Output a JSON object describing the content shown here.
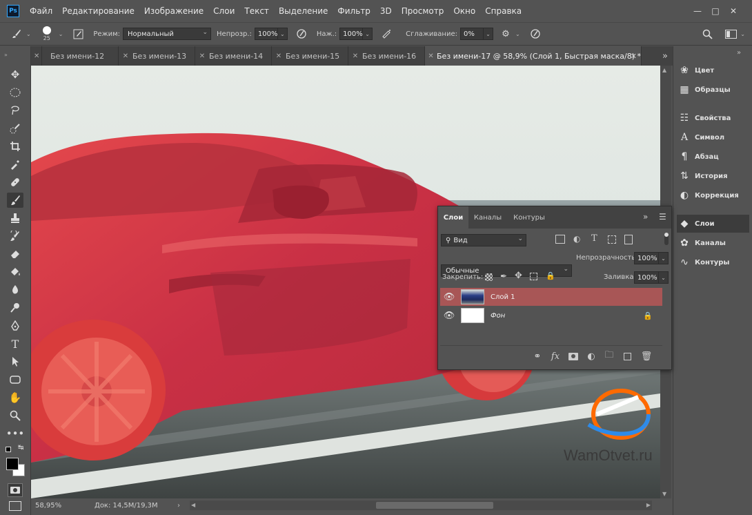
{
  "menubar": {
    "logo": "Ps",
    "items": [
      "Файл",
      "Редактирование",
      "Изображение",
      "Слои",
      "Текст",
      "Выделение",
      "Фильтр",
      "3D",
      "Просмотр",
      "Окно",
      "Справка"
    ]
  },
  "options": {
    "brush_size": "25",
    "mode_label": "Режим:",
    "mode_value": "Нормальный",
    "opacity_label": "Непрозр.:",
    "opacity_value": "100%",
    "pressure_label": "Наж.:",
    "pressure_value": "100%",
    "smoothing_label": "Сглаживание:",
    "smoothing_value": "0%"
  },
  "tabs": [
    {
      "label": "Без имени-12"
    },
    {
      "label": "Без имени-13"
    },
    {
      "label": "Без имени-14"
    },
    {
      "label": "Без имени-15"
    },
    {
      "label": "Без имени-16"
    },
    {
      "label": "Без имени-17 @ 58,9% (Слой 1, Быстрая маска/8) *",
      "active": true
    }
  ],
  "status": {
    "zoom": "58,95%",
    "doc": "Док: 14,5M/19,3M"
  },
  "watermark": "WamOtvet.ru",
  "dock": {
    "items": [
      {
        "icon": "color-icon",
        "label": "Цвет"
      },
      {
        "icon": "swatches-icon",
        "label": "Образцы"
      },
      {
        "icon": "properties-icon",
        "label": "Свойства"
      },
      {
        "icon": "character-icon",
        "label": "Символ"
      },
      {
        "icon": "paragraph-icon",
        "label": "Абзац"
      },
      {
        "icon": "history-icon",
        "label": "История"
      },
      {
        "icon": "adjustments-icon",
        "label": "Коррекция"
      },
      {
        "icon": "layers-icon",
        "label": "Слои"
      },
      {
        "icon": "channels-icon",
        "label": "Каналы"
      },
      {
        "icon": "paths-icon",
        "label": "Контуры"
      }
    ]
  },
  "layers_panel": {
    "tabs": [
      "Слои",
      "Каналы",
      "Контуры"
    ],
    "filter_label": "Вид",
    "blend_mode": "Обычные",
    "opacity_label": "Непрозрачность:",
    "opacity_value": "100%",
    "lock_label": "Закрепить:",
    "fill_label": "Заливка:",
    "fill_value": "100%",
    "layers": [
      {
        "name": "Слой 1",
        "selected": true
      },
      {
        "name": "Фон",
        "locked": true
      }
    ]
  },
  "colors": {
    "mask_red": "#e03c3c",
    "ui_bg": "#535353",
    "selected_layer": "#a85656"
  }
}
